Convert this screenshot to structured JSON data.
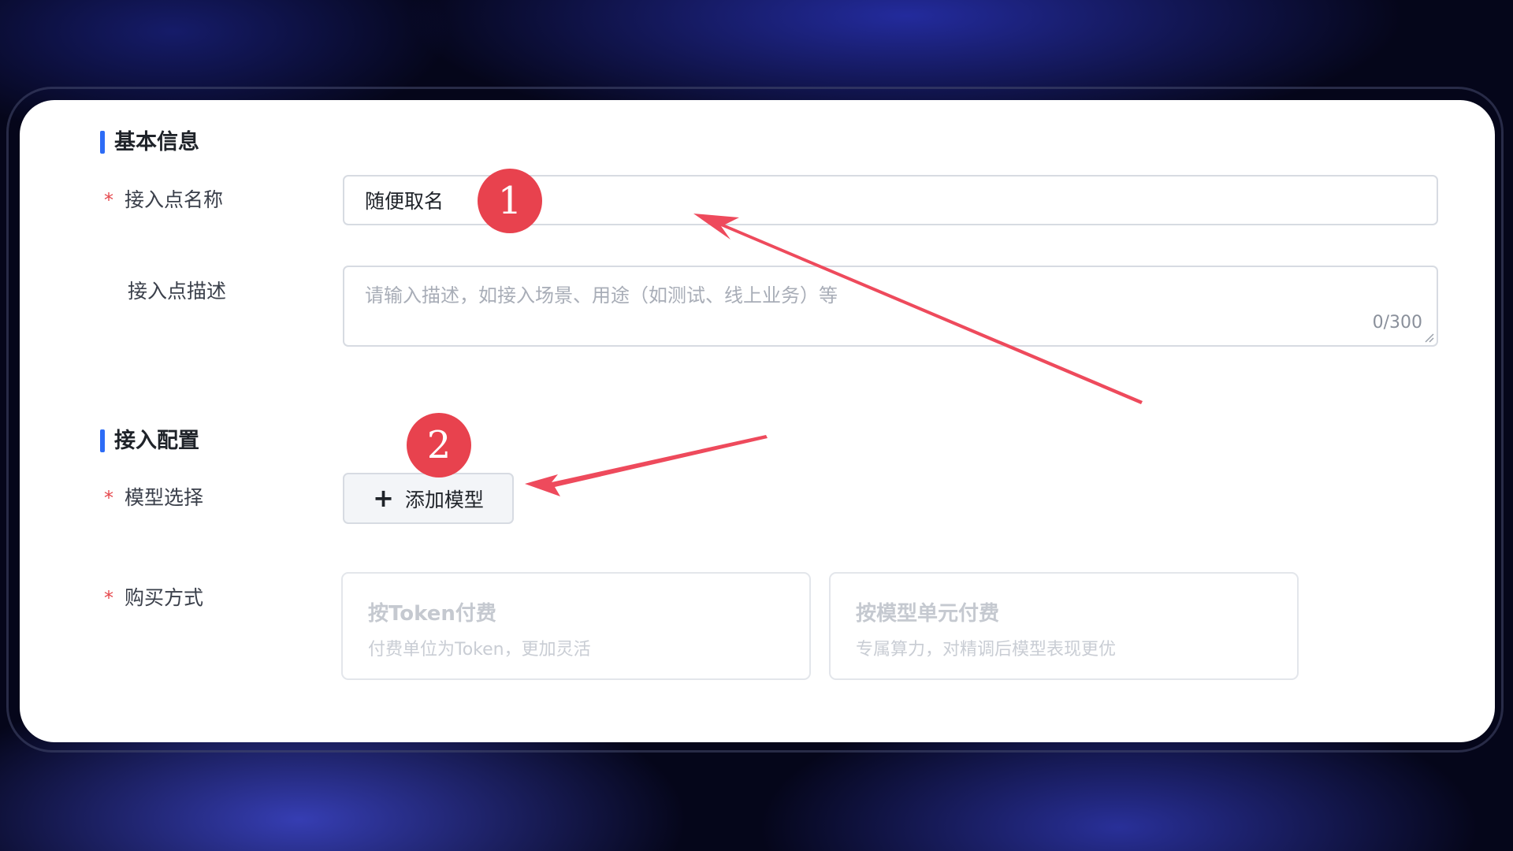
{
  "sections": {
    "basic": "基本信息",
    "config": "接入配置"
  },
  "fields": {
    "name": {
      "label": "接入点名称",
      "required": "*",
      "value": "随便取名"
    },
    "description": {
      "label": "接入点描述",
      "placeholder": "请输入描述，如接入场景、用途（如测试、线上业务）等",
      "counter": "0/300"
    },
    "model": {
      "label": "模型选择",
      "required": "*",
      "button": "添加模型",
      "icon": "plus-icon"
    },
    "purchase": {
      "label": "购买方式",
      "required": "*",
      "options": [
        {
          "title": "按Token付费",
          "desc": "付费单位为Token，更加灵活"
        },
        {
          "title": "按模型单元付费",
          "desc": "专属算力，对精调后模型表现更优"
        }
      ]
    }
  },
  "annotations": {
    "badge1": "1",
    "badge2": "2"
  },
  "colors": {
    "accent": "#2d6cf6",
    "required": "#e5484d",
    "annotation": "#e8424e"
  }
}
